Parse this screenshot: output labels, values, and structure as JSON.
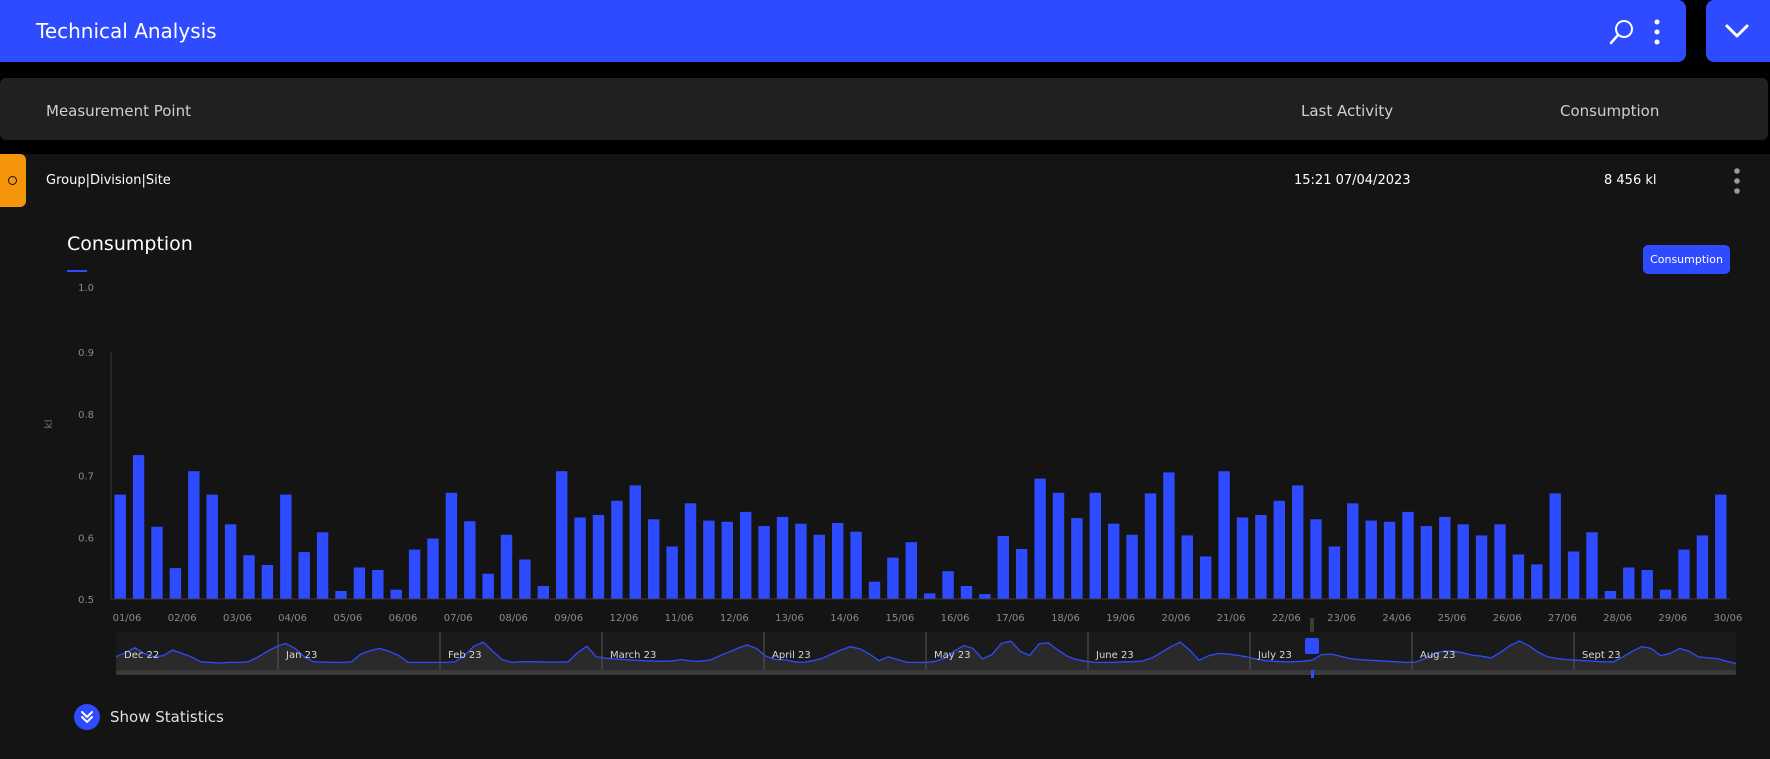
{
  "app": {
    "title": "Technical Analysis"
  },
  "table_header": {
    "col_point": "Measurement Point",
    "col_activity": "Last Activity",
    "col_consumption": "Consumption"
  },
  "row": {
    "site": "Group|Division|Site",
    "last_activity": "15:21 07/04/2023",
    "consumption": "8 456 kl",
    "status_color": "#f5960a"
  },
  "chart_panel": {
    "legend_button": "Consumption",
    "show_stats": "Show Statistics"
  },
  "colors": {
    "accent": "#2e4bff",
    "background": "#141414"
  },
  "chart_data": {
    "type": "bar",
    "title": "Consumption",
    "ylabel": "kl",
    "xlabel": "",
    "ylim": [
      0.5,
      1.0
    ],
    "yticks": [
      0.5,
      0.6,
      0.7,
      0.8,
      0.9,
      1.0
    ],
    "grid": false,
    "xtick_labels": [
      "01/06",
      "02/06",
      "03/06",
      "04/06",
      "05/06",
      "06/06",
      "07/06",
      "08/06",
      "09/06",
      "12/06",
      "11/06",
      "12/06",
      "13/06",
      "14/06",
      "15/06",
      "16/06",
      "17/06",
      "18/06",
      "19/06",
      "20/06",
      "21/06",
      "22/06",
      "23/06",
      "24/06",
      "25/06",
      "26/06",
      "27/06",
      "28/06",
      "29/06",
      "30/06"
    ],
    "values": [
      0.669,
      0.733,
      0.617,
      0.55,
      0.707,
      0.669,
      0.621,
      0.571,
      0.555,
      0.669,
      0.576,
      0.608,
      0.513,
      0.551,
      0.547,
      0.515,
      0.58,
      0.598,
      0.672,
      0.626,
      0.541,
      0.604,
      0.564,
      0.521,
      0.707,
      0.632,
      0.636,
      0.659,
      0.684,
      0.629,
      0.585,
      0.655,
      0.627,
      0.625,
      0.641,
      0.618,
      0.633,
      0.622,
      0.604,
      0.623,
      0.609,
      0.528,
      0.567,
      0.592,
      0.509,
      0.545,
      0.521,
      0.508,
      0.602,
      0.581,
      0.695,
      0.672,
      0.631,
      0.672,
      0.622,
      0.604,
      0.671,
      0.705,
      0.603,
      0.569,
      0.707,
      0.632,
      0.636,
      0.659,
      0.684,
      0.629,
      0.585,
      0.655,
      0.627,
      0.625,
      0.641,
      0.618,
      0.633,
      0.621,
      0.603,
      0.621,
      0.572,
      0.556,
      0.671,
      0.577,
      0.608,
      0.513,
      0.551,
      0.547,
      0.515,
      0.58,
      0.603,
      0.669
    ],
    "navigator": {
      "labels": [
        "Dec 22",
        "Jan 23",
        "Feb 23",
        "March 23",
        "April 23",
        "May 23",
        "June 23",
        "July 23",
        "Aug 23",
        "Sept 23"
      ],
      "series": [
        0.4,
        0.55,
        0.72,
        0.52,
        0.4,
        0.44,
        0.64,
        0.52,
        0.4,
        0.22,
        0.2,
        0.18,
        0.2,
        0.2,
        0.22,
        0.38,
        0.58,
        0.76,
        0.88,
        0.7,
        0.4,
        0.22,
        0.21,
        0.2,
        0.2,
        0.22,
        0.5,
        0.62,
        0.7,
        0.6,
        0.45,
        0.2,
        0.2,
        0.2,
        0.2,
        0.2,
        0.22,
        0.45,
        0.78,
        0.92,
        0.6,
        0.3,
        0.2,
        0.22,
        0.22,
        0.22,
        0.21,
        0.21,
        0.22,
        0.55,
        0.78,
        0.4,
        0.35,
        0.32,
        0.3,
        0.28,
        0.26,
        0.25,
        0.24,
        0.25,
        0.3,
        0.25,
        0.24,
        0.28,
        0.42,
        0.56,
        0.7,
        0.82,
        0.7,
        0.42,
        0.3,
        0.3,
        0.22,
        0.2,
        0.26,
        0.35,
        0.5,
        0.65,
        0.76,
        0.68,
        0.5,
        0.26,
        0.4,
        0.3,
        0.2,
        0.2,
        0.2,
        0.24,
        0.35,
        0.6,
        0.8,
        0.7,
        0.32,
        0.48,
        0.88,
        0.96,
        0.6,
        0.44,
        0.86,
        0.9,
        0.64,
        0.42,
        0.3,
        0.24,
        0.2,
        0.2,
        0.2,
        0.22,
        0.22,
        0.25,
        0.36,
        0.56,
        0.76,
        0.92,
        0.64,
        0.28,
        0.44,
        0.52,
        0.5,
        0.46,
        0.4,
        0.32,
        0.26,
        0.24,
        0.22,
        0.22,
        0.24,
        0.28,
        0.48,
        0.5,
        0.42,
        0.34,
        0.3,
        0.28,
        0.26,
        0.24,
        0.22,
        0.2,
        0.21,
        0.34,
        0.52,
        0.6,
        0.6,
        0.54,
        0.46,
        0.42,
        0.36,
        0.56,
        0.8,
        0.96,
        0.8,
        0.56,
        0.4,
        0.34,
        0.3,
        0.28,
        0.26,
        0.24,
        0.22,
        0.22,
        0.4,
        0.6,
        0.76,
        0.7,
        0.44,
        0.52,
        0.7,
        0.6,
        0.4,
        0.36,
        0.34,
        0.24,
        0.16
      ],
      "selection_label": "Jul"
    }
  }
}
